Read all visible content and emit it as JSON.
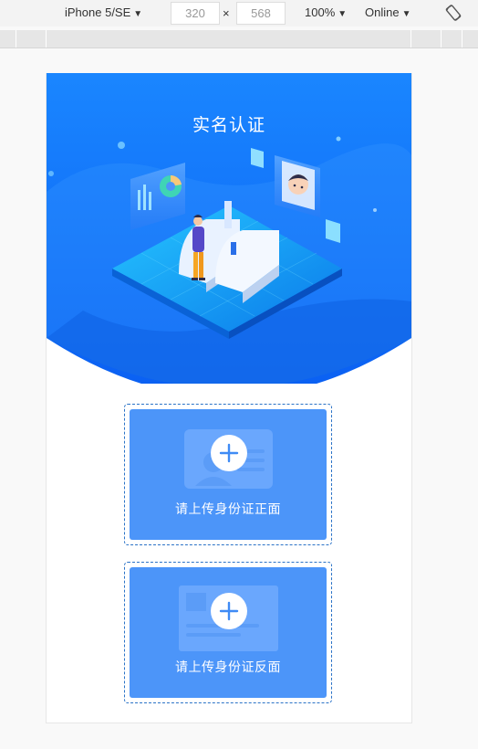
{
  "toolbar": {
    "device_name": "iPhone 5/SE",
    "width_value": "320",
    "height_value": "568",
    "times_sign": "×",
    "zoom": "100%",
    "network": "Online",
    "rotate_icon": "rotate-icon",
    "caret_icon": "▼"
  },
  "page": {
    "title": "实名认证",
    "upload_front_label": "请上传身份证正面",
    "upload_back_label": "请上传身份证反面",
    "colors": {
      "hero_top": "#1e7dff",
      "hero_bottom": "#0a5cf0",
      "card_bg": "#4c95f9",
      "border": "#2b73c7"
    }
  }
}
